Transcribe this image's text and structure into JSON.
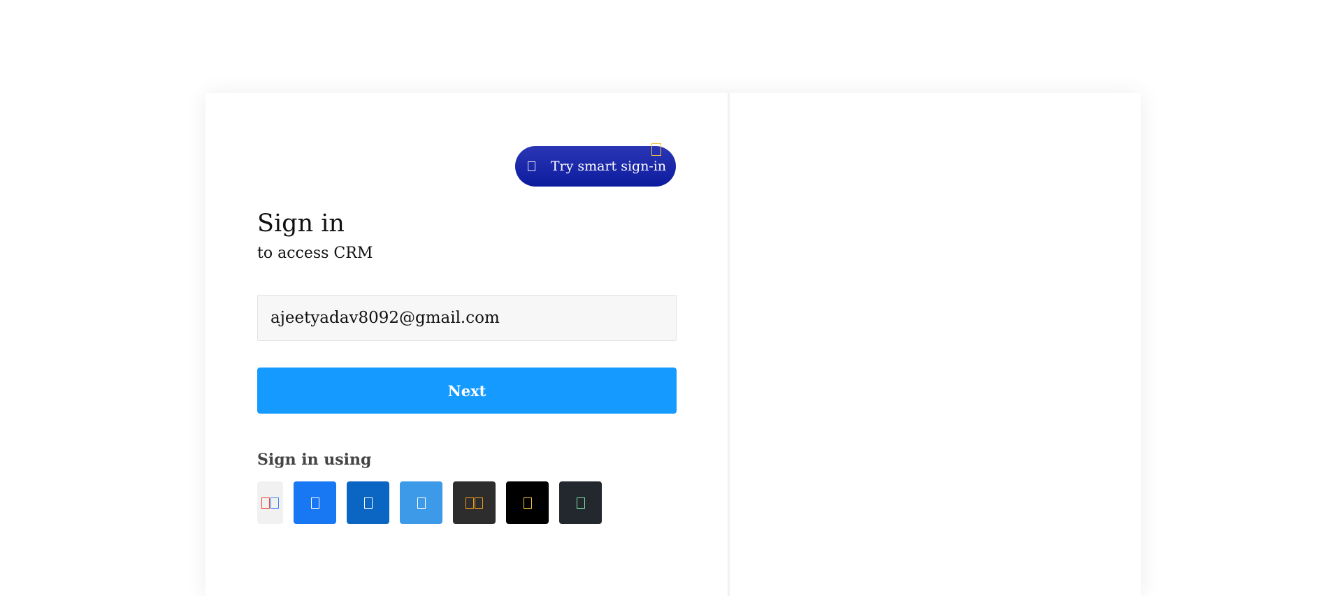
{
  "smart_signin": {
    "label": "Try smart sign-in"
  },
  "heading": {
    "title": "Sign in",
    "subtitle": "to access CRM"
  },
  "email_field": {
    "value": "ajeetyadav8092@gmail.com"
  },
  "next_button": {
    "label": "Next"
  },
  "sign_in_using": {
    "label": "Sign in using",
    "providers": [
      {
        "icon": "google-icon",
        "bg": "#f1f1f1"
      },
      {
        "icon": "facebook-icon",
        "bg": "#1877f2"
      },
      {
        "icon": "linkedin-icon",
        "bg": "#0a66c2"
      },
      {
        "icon": "twitter-icon",
        "bg": "#3d9ae8"
      },
      {
        "icon": "microsoft-icon",
        "bg": "#2d2d2d"
      },
      {
        "icon": "apple-icon",
        "bg": "#000000"
      },
      {
        "icon": "github-icon",
        "bg": "#23272e"
      }
    ]
  },
  "colors": {
    "smart_signin_bg": "#1a2aa8",
    "next_button_bg": "#159aff",
    "email_field_bg": "#f7f7f7"
  }
}
